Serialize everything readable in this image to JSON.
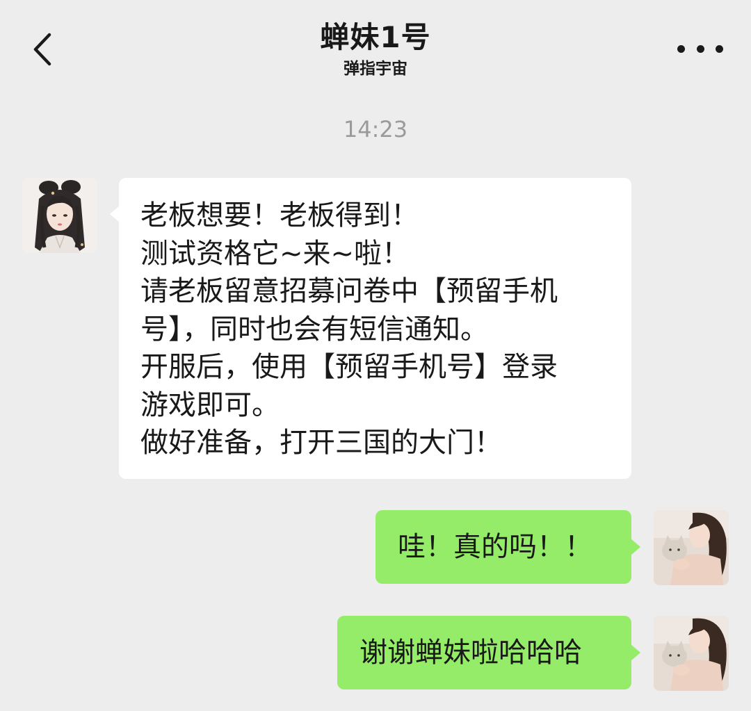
{
  "header": {
    "back_icon": "chevron-left-icon",
    "title": "蝉妹1号",
    "subtitle": "弹指宇宙",
    "more_icon": "more-dots-icon"
  },
  "colors": {
    "background": "#ededed",
    "incoming_bubble": "#ffffff",
    "outgoing_bubble": "#95ec69",
    "timestamp_text": "#9a9a9a"
  },
  "timestamp": "14:23",
  "messages": [
    {
      "direction": "incoming",
      "avatar": "ancient-lady-illustration-avatar",
      "lines": [
        "老板想要！老板得到！",
        "测试资格它~来~啦！",
        "请老板留意招募问卷中【预留手机",
        "号】，同时也会有短信通知。",
        "开服后，使用【预留手机号】登录",
        "游戏即可。",
        "做好准备，打开三国的大门！"
      ]
    },
    {
      "direction": "outgoing",
      "avatar": "girl-with-cat-photo-avatar",
      "text": "哇！真的吗！！"
    },
    {
      "direction": "outgoing",
      "avatar": "girl-with-cat-photo-avatar",
      "text": "谢谢蝉妹啦哈哈哈"
    }
  ]
}
